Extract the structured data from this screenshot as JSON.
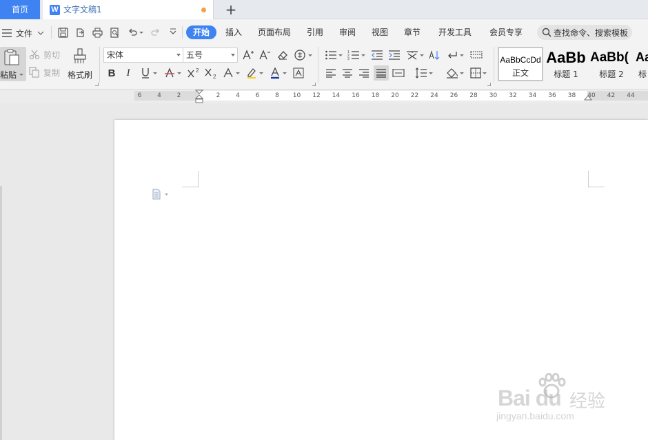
{
  "tabs": {
    "home": "首页",
    "document": "文字文稿1",
    "doc_icon_letter": "W"
  },
  "menubar": {
    "file": "文件",
    "items": [
      "开始",
      "插入",
      "页面布局",
      "引用",
      "审阅",
      "视图",
      "章节",
      "开发工具",
      "会员专享"
    ],
    "active_index": 0,
    "search_placeholder": "查找命令、搜索模板"
  },
  "ribbon": {
    "paste": "粘贴",
    "cut": "剪切",
    "copy": "复制",
    "format_painter": "格式刷",
    "font_name": "宋体",
    "font_size": "五号",
    "styles": [
      {
        "sample": "AaBbCcDd",
        "caption": "正文"
      },
      {
        "sample": "AaBb",
        "caption": "标题 1"
      },
      {
        "sample": "AaBb(",
        "caption": "标题 2"
      },
      {
        "sample": "Aa",
        "caption": "标"
      }
    ]
  },
  "ruler": {
    "labels": [
      "6",
      "4",
      "2",
      "2",
      "4",
      "6",
      "8",
      "10",
      "12",
      "14",
      "16",
      "18",
      "20",
      "22",
      "24",
      "26",
      "28",
      "30",
      "32",
      "34",
      "36",
      "38",
      "40",
      "42",
      "44"
    ]
  },
  "watermark": {
    "logo": "Bai du",
    "cn": "经验",
    "url": "jingyan.baidu.com"
  },
  "colors": {
    "accent": "#3f83f2",
    "unsaved_dot": "#f1a046",
    "font_color_underline": "#1c3aa9"
  }
}
